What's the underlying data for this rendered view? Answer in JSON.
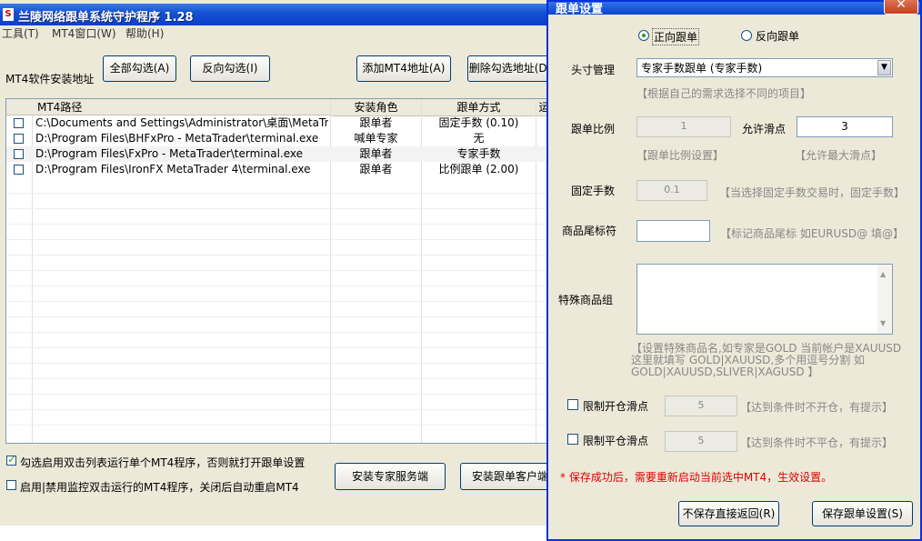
{
  "main": {
    "title": "兰陵网络跟单系统守护程序 1.28",
    "menu": [
      "工具(T)",
      "MT4窗口(W)",
      "帮助(H)"
    ],
    "address_label": "MT4软件安装地址",
    "buttons": {
      "select_all": "全部勾选(A)",
      "invert_select": "反向勾选(I)",
      "add_mt4": "添加MT4地址(A)",
      "delete_selected": "删除勾选地址(D)",
      "install_server": "安装专家服务端",
      "install_client": "安装跟单客户端"
    },
    "table": {
      "headers": [
        "MT4路径",
        "安装角色",
        "跟单方式",
        "运"
      ],
      "rows": [
        {
          "path": "C:\\Documents and Settings\\Administrator\\桌面\\MetaTr...",
          "role": "跟单者",
          "mode": "固定手数 (0.10)",
          "checked": false
        },
        {
          "path": "D:\\Program Files\\BHFxPro - MetaTrader\\terminal.exe",
          "role": "喊单专家",
          "mode": "无",
          "checked": false
        },
        {
          "path": "D:\\Program Files\\FxPro - MetaTrader\\terminal.exe",
          "role": "跟单者",
          "mode": "专家手数",
          "checked": false
        },
        {
          "path": "D:\\Program Files\\IronFX MetaTrader 4\\terminal.exe",
          "role": "跟单者",
          "mode": "比例跟单 (2.00)",
          "checked": false
        }
      ]
    },
    "options": {
      "dblclick": {
        "label": "勾选启用双击列表运行单个MT4程序，否则就打开跟单设置",
        "checked": true
      },
      "monitor": {
        "label": "启用|禁用监控双击运行的MT4程序，关闭后自动重启MT4",
        "checked": false
      }
    }
  },
  "dialog": {
    "title": "跟单设置",
    "close_symbol": "✕",
    "direction": {
      "forward": "正向跟单",
      "reverse": "反向跟单",
      "selected": "forward"
    },
    "position_mgmt": {
      "label": "头寸管理",
      "value": "专家手数跟单 (专家手数)",
      "hint": "【根据自己的需求选择不同的项目】"
    },
    "ratio": {
      "label": "跟单比例",
      "value": "1",
      "hint": "【跟单比例设置】"
    },
    "slippage": {
      "label": "允许滑点",
      "value": "3",
      "hint": "【允许最大滑点】"
    },
    "fixed_lots": {
      "label": "固定手数",
      "value": "0.1",
      "hint": "【当选择固定手数交易时，固定手数】"
    },
    "suffix": {
      "label": "商品尾标符",
      "value": "",
      "hint": "【标记商品尾标 如EURUSD@ 填@】"
    },
    "special": {
      "label": "特殊商品组",
      "value": "",
      "hint_lines": [
        "【设置特殊商品名,如专家是GOLD 当前帐户是XAUUSD",
        "这里就填写 GOLD|XAUUSD,多个用逗号分割 如",
        "GOLD|XAUUSD,SLIVER|XAGUSD 】"
      ]
    },
    "open_slip": {
      "label": "限制开仓滑点",
      "value": "5",
      "hint": "【达到条件时不开仓，有提示】",
      "checked": false
    },
    "close_slip": {
      "label": "限制平仓滑点",
      "value": "5",
      "hint": "【达到条件时不平仓，有提示】",
      "checked": false
    },
    "warning": "* 保存成功后，需要重新启动当前选中MT4，生效设置。",
    "buttons": {
      "cancel": "不保存直接返回(R)",
      "save": "保存跟单设置(S)"
    }
  },
  "colors": {
    "title_blue": "#0a40c8",
    "warning_red": "#e00000",
    "checkmark_green": "#21a121"
  }
}
